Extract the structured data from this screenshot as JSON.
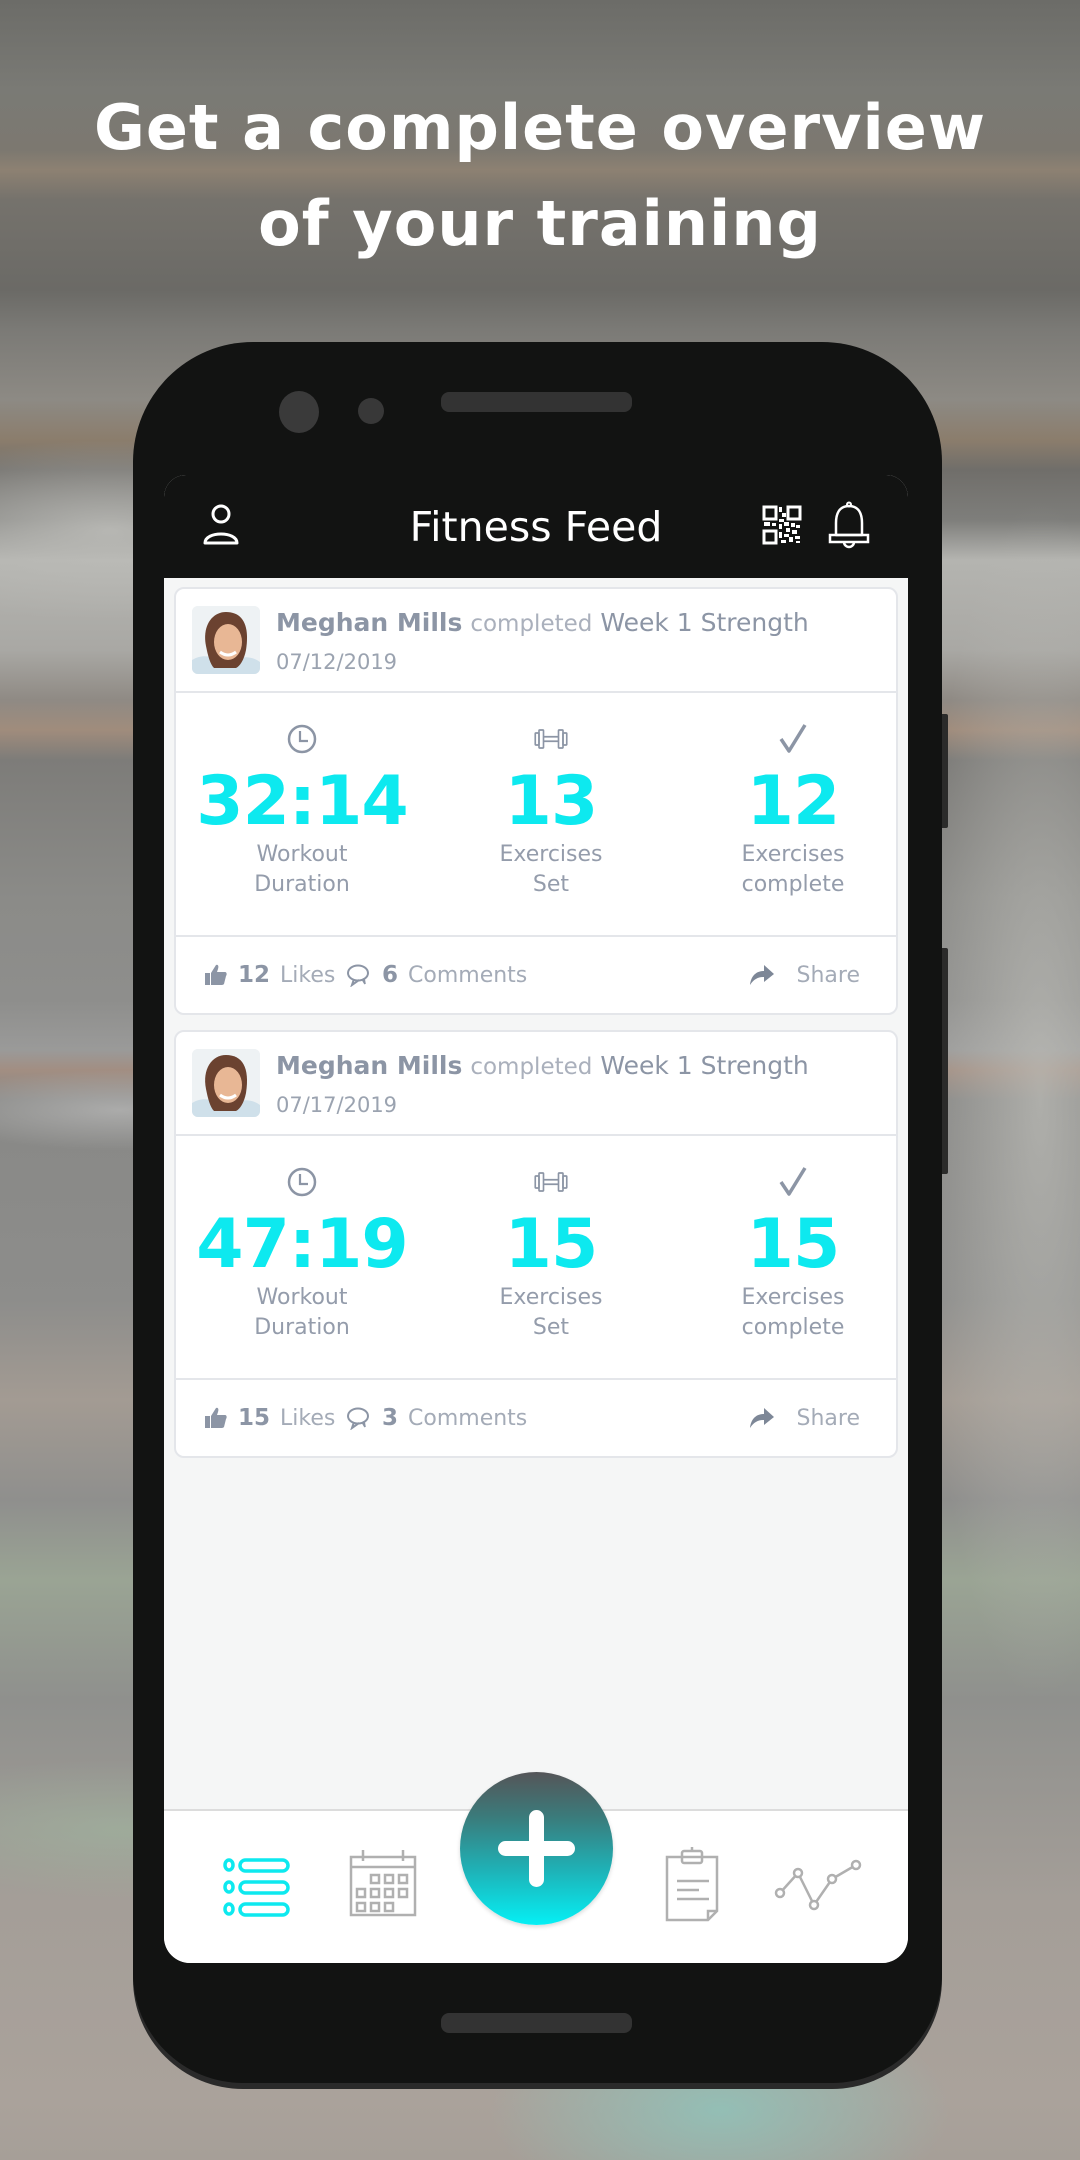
{
  "promo": {
    "headline_line1": "Get a complete overview",
    "headline_line2": "of your training"
  },
  "app": {
    "title": "Fitness Feed",
    "accent_color": "#0de9ef",
    "header_icons": [
      "profile-icon",
      "qr-code-icon",
      "bell-icon"
    ]
  },
  "feed": {
    "posts": [
      {
        "user_name": "Meghan Mills",
        "verb": "completed",
        "workout_name": "Week 1 Strength",
        "date": "07/12/2019",
        "stats": [
          {
            "icon": "clock-icon",
            "value": "32:14",
            "label_line1": "Workout",
            "label_line2": "Duration"
          },
          {
            "icon": "dumbbell-icon",
            "value": "13",
            "label_line1": "Exercises",
            "label_line2": "Set"
          },
          {
            "icon": "checkmark-icon",
            "value": "12",
            "label_line1": "Exercises",
            "label_line2": "complete"
          }
        ],
        "likes_count": "12",
        "likes_label": "Likes",
        "comments_count": "6",
        "comments_label": "Comments",
        "share_label": "Share"
      },
      {
        "user_name": "Meghan Mills",
        "verb": "completed",
        "workout_name": "Week 1 Strength",
        "date": "07/17/2019",
        "stats": [
          {
            "icon": "clock-icon",
            "value": "47:19",
            "label_line1": "Workout",
            "label_line2": "Duration"
          },
          {
            "icon": "dumbbell-icon",
            "value": "15",
            "label_line1": "Exercises",
            "label_line2": "Set"
          },
          {
            "icon": "checkmark-icon",
            "value": "15",
            "label_line1": "Exercises",
            "label_line2": "complete"
          }
        ],
        "likes_count": "15",
        "likes_label": "Likes",
        "comments_count": "3",
        "comments_label": "Comments",
        "share_label": "Share"
      }
    ]
  },
  "bottom_nav": {
    "items": [
      {
        "icon": "list-icon",
        "active": true
      },
      {
        "icon": "calendar-icon",
        "active": false
      },
      {
        "icon": "plus-icon",
        "active": false
      },
      {
        "icon": "clipboard-icon",
        "active": false
      },
      {
        "icon": "progress-chart-icon",
        "active": false
      }
    ]
  }
}
